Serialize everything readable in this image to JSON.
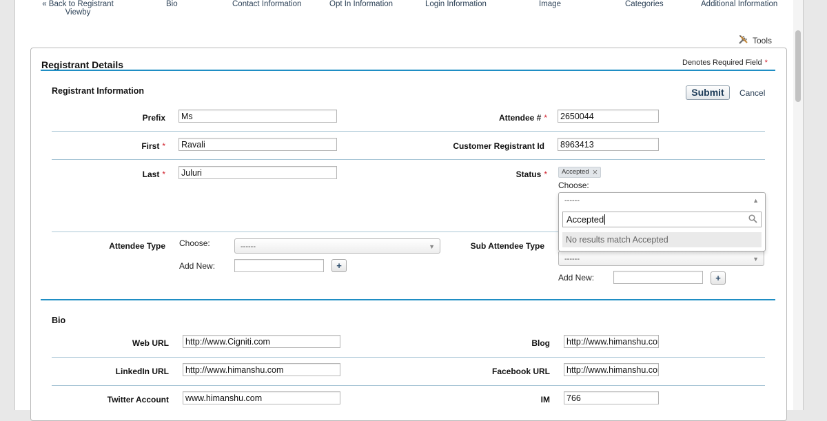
{
  "nav": {
    "back": "« Back to Registrant",
    "back_line2": "Viewby",
    "bio": "Bio",
    "contact": "Contact Information",
    "optin": "Opt In Information",
    "login": "Login Information",
    "image": "Image",
    "categories": "Categories",
    "additional": "Additional Information"
  },
  "tools_label": "Tools",
  "panel": {
    "title": "Registrant Details",
    "required_note": "Denotes Required Field",
    "required_marker": "*"
  },
  "registrant_info": {
    "heading": "Registrant Information",
    "submit": "Submit",
    "cancel": "Cancel",
    "prefix_label": "Prefix",
    "prefix_value": "Ms",
    "first_label": "First",
    "first_value": "Ravali",
    "last_label": "Last",
    "last_value": "Juluri",
    "attendee_num_label": "Attendee #",
    "attendee_num_value": "2650044",
    "customer_id_label": "Customer Registrant Id",
    "customer_id_value": "8963413",
    "status_label": "Status",
    "status_tag": "Accepted",
    "status_tag_remove": "×",
    "choose_label": "Choose:",
    "status_dropdown": {
      "selected": "------",
      "search_value": "Accepted",
      "no_results": "No results match Accepted"
    },
    "attendee_type_label": "Attendee Type",
    "attendee_type_choose": "Choose:",
    "attendee_type_selected": "------",
    "add_new_label": "Add New:",
    "add_new_value": "",
    "plus": "+",
    "sub_attendee_type_label": "Sub Attendee Type",
    "sub_attendee_selected": "------",
    "sub_add_new_label": "Add New:"
  },
  "bio": {
    "heading": "Bio",
    "web_url_label": "Web URL",
    "web_url_value": "http://www.Cigniti.com",
    "blog_label": "Blog",
    "blog_value": "http://www.himanshu.com",
    "linkedin_label": "LinkedIn URL",
    "linkedin_value": "http://www.himanshu.com",
    "facebook_label": "Facebook URL",
    "facebook_value": "http://www.himanshu.com",
    "twitter_label": "Twitter Account",
    "twitter_value": "www.himanshu.com",
    "im_label": "IM",
    "im_value": "766"
  },
  "colors": {
    "accent_rule": "#1f8ec4",
    "required": "#d0202c",
    "link": "#2a3f55"
  },
  "icons": [
    "tools-icon",
    "remove-tag-icon",
    "search-icon",
    "caret-down-icon",
    "caret-up-icon"
  ]
}
